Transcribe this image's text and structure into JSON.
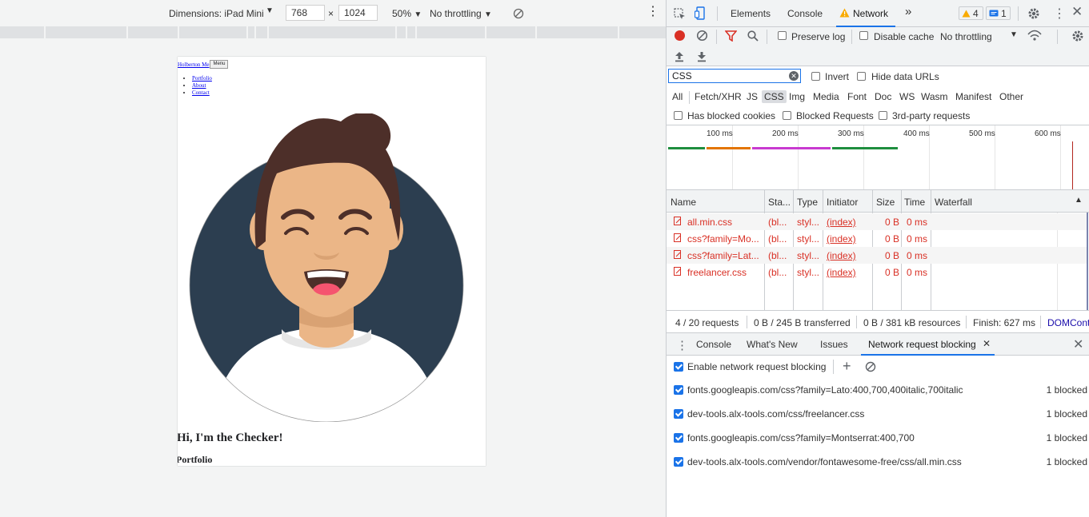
{
  "device_toolbar": {
    "dimensions_label": "Dimensions: iPad Mini",
    "width_value": "768",
    "height_value": "1024",
    "times": "×",
    "zoom": "50%",
    "throttling": "No throttling"
  },
  "page": {
    "site_link": "Holberton Me",
    "menu_button": "Menu",
    "nav_links": [
      "Portfolio",
      "About",
      "Contact"
    ],
    "heading": "Hi, I'm the Checker!",
    "subheading": "Portfolio",
    "colors": {
      "circle": "#2c3e50",
      "hair": "#4d2f29",
      "skin": "#ebb687",
      "shirt": "#ffffff"
    }
  },
  "devtools": {
    "tabs": [
      "Elements",
      "Console",
      "Network"
    ],
    "active_tab": "Network",
    "warnings_count": "4",
    "messages_count": "1",
    "toolbar": {
      "preserve_log": "Preserve log",
      "disable_cache": "Disable cache",
      "throttling": "No throttling"
    },
    "filter": {
      "value": "CSS",
      "invert": "Invert",
      "hide_data_urls": "Hide data URLs"
    },
    "types": [
      "All",
      "Fetch/XHR",
      "JS",
      "CSS",
      "Img",
      "Media",
      "Font",
      "Doc",
      "WS",
      "Wasm",
      "Manifest",
      "Other"
    ],
    "active_type": "CSS",
    "checkboxes": {
      "blocked_cookies": "Has blocked cookies",
      "blocked_requests": "Blocked Requests",
      "third_party": "3rd-party requests"
    },
    "timeline_ticks": [
      "100 ms",
      "200 ms",
      "300 ms",
      "400 ms",
      "500 ms",
      "600 ms"
    ],
    "table": {
      "headers": [
        "Name",
        "Sta...",
        "Type",
        "Initiator",
        "Size",
        "Time",
        "Waterfall"
      ],
      "rows": [
        {
          "name": "all.min.css",
          "status": "(bl...",
          "type": "styl...",
          "initiator": "(index)",
          "size": "0 B",
          "time": "0 ms"
        },
        {
          "name": "css?family=Mo...",
          "status": "(bl...",
          "type": "styl...",
          "initiator": "(index)",
          "size": "0 B",
          "time": "0 ms"
        },
        {
          "name": "css?family=Lat...",
          "status": "(bl...",
          "type": "styl...",
          "initiator": "(index)",
          "size": "0 B",
          "time": "0 ms"
        },
        {
          "name": "freelancer.css",
          "status": "(bl...",
          "type": "styl...",
          "initiator": "(index)",
          "size": "0 B",
          "time": "0 ms"
        }
      ]
    },
    "summary": {
      "requests": "4 / 20 requests",
      "transferred": "0 B / 245 B transferred",
      "resources": "0 B / 381 kB resources",
      "finish": "Finish: 627 ms",
      "domcontent": "DOMCont"
    },
    "drawer": {
      "tabs": [
        "Console",
        "What's New",
        "Issues",
        "Network request blocking"
      ],
      "active_tab": "Network request blocking",
      "enable_label": "Enable network request blocking",
      "rules": [
        {
          "pattern": "fonts.googleapis.com/css?family=Lato:400,700,400italic,700italic",
          "count": "1 blocked"
        },
        {
          "pattern": "dev-tools.alx-tools.com/css/freelancer.css",
          "count": "1 blocked"
        },
        {
          "pattern": "fonts.googleapis.com/css?family=Montserrat:400,700",
          "count": "1 blocked"
        },
        {
          "pattern": "dev-tools.alx-tools.com/vendor/fontawesome-free/css/all.min.css",
          "count": "1 blocked"
        }
      ]
    }
  }
}
